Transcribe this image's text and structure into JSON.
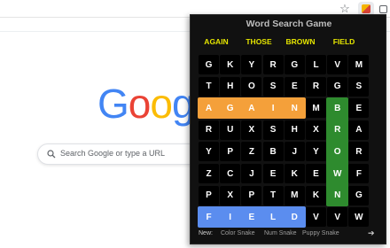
{
  "browser": {
    "star_icon": "☆",
    "extension_icon": "word-search-extension-icon",
    "puzzle_icon": "extensions-icon"
  },
  "google": {
    "logo_letters": [
      {
        "char": "G",
        "color": "#4285f4"
      },
      {
        "char": "o",
        "color": "#ea4335"
      },
      {
        "char": "o",
        "color": "#fbbc05"
      },
      {
        "char": "g",
        "color": "#4285f4"
      }
    ],
    "search_placeholder": "Search Google or type a URL"
  },
  "game": {
    "title": "Word Search Game",
    "words": [
      "AGAIN",
      "THOSE",
      "BROWN",
      "FIELD"
    ],
    "grid": [
      [
        "G",
        "K",
        "Y",
        "R",
        "G",
        "L",
        "V",
        "M"
      ],
      [
        "T",
        "H",
        "O",
        "S",
        "E",
        "R",
        "G",
        "S"
      ],
      [
        "A",
        "G",
        "A",
        "I",
        "N",
        "M",
        "B",
        "E"
      ],
      [
        "R",
        "U",
        "X",
        "S",
        "H",
        "X",
        "R",
        "A"
      ],
      [
        "Y",
        "P",
        "Z",
        "B",
        "J",
        "Y",
        "O",
        "R"
      ],
      [
        "Z",
        "C",
        "J",
        "E",
        "K",
        "E",
        "W",
        "F"
      ],
      [
        "P",
        "X",
        "P",
        "T",
        "M",
        "K",
        "N",
        "G"
      ],
      [
        "F",
        "I",
        "E",
        "L",
        "D",
        "V",
        "V",
        "W"
      ]
    ],
    "highlights": [
      {
        "word": "AGAIN",
        "color": "#f4a03a",
        "row": 2,
        "col": 0,
        "dir": "h",
        "len": 5
      },
      {
        "word": "BROWN",
        "color": "#2e8b2e",
        "row": 2,
        "col": 6,
        "dir": "v",
        "len": 5
      },
      {
        "word": "FIELD",
        "color": "#5b8def",
        "row": 7,
        "col": 0,
        "dir": "h",
        "len": 5
      }
    ],
    "footer": {
      "new_label": "New:",
      "options": [
        "Color Snake",
        "Num Snake",
        "Puppy Snake"
      ],
      "arrow": "➔"
    }
  }
}
